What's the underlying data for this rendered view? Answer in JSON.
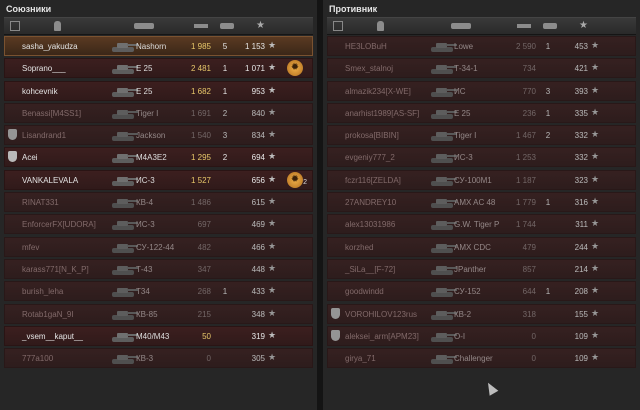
{
  "allies": {
    "title": "Союзники",
    "rows": [
      {
        "name": "sasha_yakudza",
        "tank": "Nashorn",
        "damage": "1 985",
        "frags": "5",
        "xp": "1 153",
        "platoon": false,
        "self": true,
        "dead": false,
        "medal": false,
        "medal_count": ""
      },
      {
        "name": "Soprano___",
        "tank": "E 25",
        "damage": "2 481",
        "frags": "1",
        "xp": "1 071",
        "platoon": false,
        "self": false,
        "dead": false,
        "medal": true,
        "medal_count": ""
      },
      {
        "name": "kohcevnik",
        "tank": "E 25",
        "damage": "1 682",
        "frags": "1",
        "xp": "953",
        "platoon": false,
        "self": false,
        "dead": false,
        "medal": false,
        "medal_count": ""
      },
      {
        "name": "Benassi[M4SS1]",
        "tank": "Tiger I",
        "damage": "1 691",
        "frags": "2",
        "xp": "840",
        "platoon": false,
        "self": false,
        "dead": true,
        "medal": false,
        "medal_count": ""
      },
      {
        "name": "Lisandrand1",
        "tank": "Jackson",
        "damage": "1 540",
        "frags": "3",
        "xp": "834",
        "platoon": true,
        "self": false,
        "dead": true,
        "medal": false,
        "medal_count": ""
      },
      {
        "name": "Acei",
        "tank": "M4A3E2",
        "damage": "1 295",
        "frags": "2",
        "xp": "694",
        "platoon": true,
        "self": false,
        "dead": false,
        "medal": false,
        "medal_count": ""
      },
      {
        "name": "VANKALEVALA",
        "tank": "ИС-3",
        "damage": "1 527",
        "frags": "",
        "xp": "656",
        "platoon": false,
        "self": false,
        "dead": false,
        "medal": true,
        "medal_count": "2"
      },
      {
        "name": "RINAT331",
        "tank": "КВ-4",
        "damage": "1 486",
        "frags": "",
        "xp": "615",
        "platoon": false,
        "self": false,
        "dead": true,
        "medal": false,
        "medal_count": ""
      },
      {
        "name": "EnforcerFX[UDORA]",
        "tank": "ИС-3",
        "damage": "697",
        "frags": "",
        "xp": "469",
        "platoon": false,
        "self": false,
        "dead": true,
        "medal": false,
        "medal_count": ""
      },
      {
        "name": "mfev",
        "tank": "СУ-122-44",
        "damage": "482",
        "frags": "",
        "xp": "466",
        "platoon": false,
        "self": false,
        "dead": true,
        "medal": false,
        "medal_count": ""
      },
      {
        "name": "karass771[N_K_P]",
        "tank": "Т-43",
        "damage": "347",
        "frags": "",
        "xp": "448",
        "platoon": false,
        "self": false,
        "dead": true,
        "medal": false,
        "medal_count": ""
      },
      {
        "name": "burish_leha",
        "tank": "T34",
        "damage": "268",
        "frags": "1",
        "xp": "433",
        "platoon": false,
        "self": false,
        "dead": true,
        "medal": false,
        "medal_count": ""
      },
      {
        "name": "Rotab1gaN_9I",
        "tank": "КВ-85",
        "damage": "215",
        "frags": "",
        "xp": "348",
        "platoon": false,
        "self": false,
        "dead": true,
        "medal": false,
        "medal_count": ""
      },
      {
        "name": "_vsem__kaput__",
        "tank": "M40/M43",
        "damage": "50",
        "frags": "",
        "xp": "319",
        "platoon": false,
        "self": false,
        "dead": false,
        "medal": false,
        "medal_count": ""
      },
      {
        "name": "777a100",
        "tank": "КВ-3",
        "damage": "0",
        "frags": "",
        "xp": "305",
        "platoon": false,
        "self": false,
        "dead": true,
        "medal": false,
        "medal_count": ""
      }
    ]
  },
  "enemies": {
    "title": "Противник",
    "rows": [
      {
        "name": "HE3LOBuH",
        "tank": "Lowe",
        "damage": "2 590",
        "frags": "1",
        "xp": "453",
        "platoon": false,
        "dead": true
      },
      {
        "name": "Smex_stalnoj",
        "tank": "Т-34-1",
        "damage": "734",
        "frags": "",
        "xp": "421",
        "platoon": false,
        "dead": true
      },
      {
        "name": "almazik234[X-WE]",
        "tank": "ИС",
        "damage": "770",
        "frags": "3",
        "xp": "393",
        "platoon": false,
        "dead": true
      },
      {
        "name": "anarhist1989[AS-SF]",
        "tank": "E 25",
        "damage": "236",
        "frags": "1",
        "xp": "335",
        "platoon": false,
        "dead": true
      },
      {
        "name": "prokosa[BIBIN]",
        "tank": "Tiger I",
        "damage": "1 467",
        "frags": "2",
        "xp": "332",
        "platoon": false,
        "dead": true
      },
      {
        "name": "evgeniy777_2",
        "tank": "ИС-3",
        "damage": "1 253",
        "frags": "",
        "xp": "332",
        "platoon": false,
        "dead": true
      },
      {
        "name": "fczr116[ZELDA]",
        "tank": "СУ-100М1",
        "damage": "1 187",
        "frags": "",
        "xp": "323",
        "platoon": false,
        "dead": true
      },
      {
        "name": "27ANDREY10",
        "tank": "AMX AC 48",
        "damage": "1 779",
        "frags": "1",
        "xp": "316",
        "platoon": false,
        "dead": true
      },
      {
        "name": "alex13031986",
        "tank": "G.W. Tiger P",
        "damage": "1 744",
        "frags": "",
        "xp": "311",
        "platoon": false,
        "dead": true
      },
      {
        "name": "korzhed",
        "tank": "AMX CDC",
        "damage": "479",
        "frags": "",
        "xp": "244",
        "platoon": false,
        "dead": true
      },
      {
        "name": "_SiLa__[F-72]",
        "tank": "JPanther",
        "damage": "857",
        "frags": "",
        "xp": "214",
        "platoon": false,
        "dead": true
      },
      {
        "name": "goodwindd",
        "tank": "СУ-152",
        "damage": "644",
        "frags": "1",
        "xp": "208",
        "platoon": false,
        "dead": true
      },
      {
        "name": "VOROHILOV123rus",
        "tank": "КВ-2",
        "damage": "318",
        "frags": "",
        "xp": "155",
        "platoon": true,
        "dead": true
      },
      {
        "name": "aleksei_arm[APM23]",
        "tank": "О-I",
        "damage": "0",
        "frags": "",
        "xp": "109",
        "platoon": true,
        "dead": true
      },
      {
        "name": "girya_71",
        "tank": "Challenger",
        "damage": "0",
        "frags": "",
        "xp": "109",
        "platoon": false,
        "dead": true
      }
    ]
  },
  "colors": {
    "row_bg": "#3c1f1f",
    "self_bg": "#5a3a22",
    "damage": "#e8c86a",
    "medal": "#f1b14a"
  },
  "icons": {
    "star": "★",
    "medal": "✹",
    "platoon": "shield-icon"
  }
}
